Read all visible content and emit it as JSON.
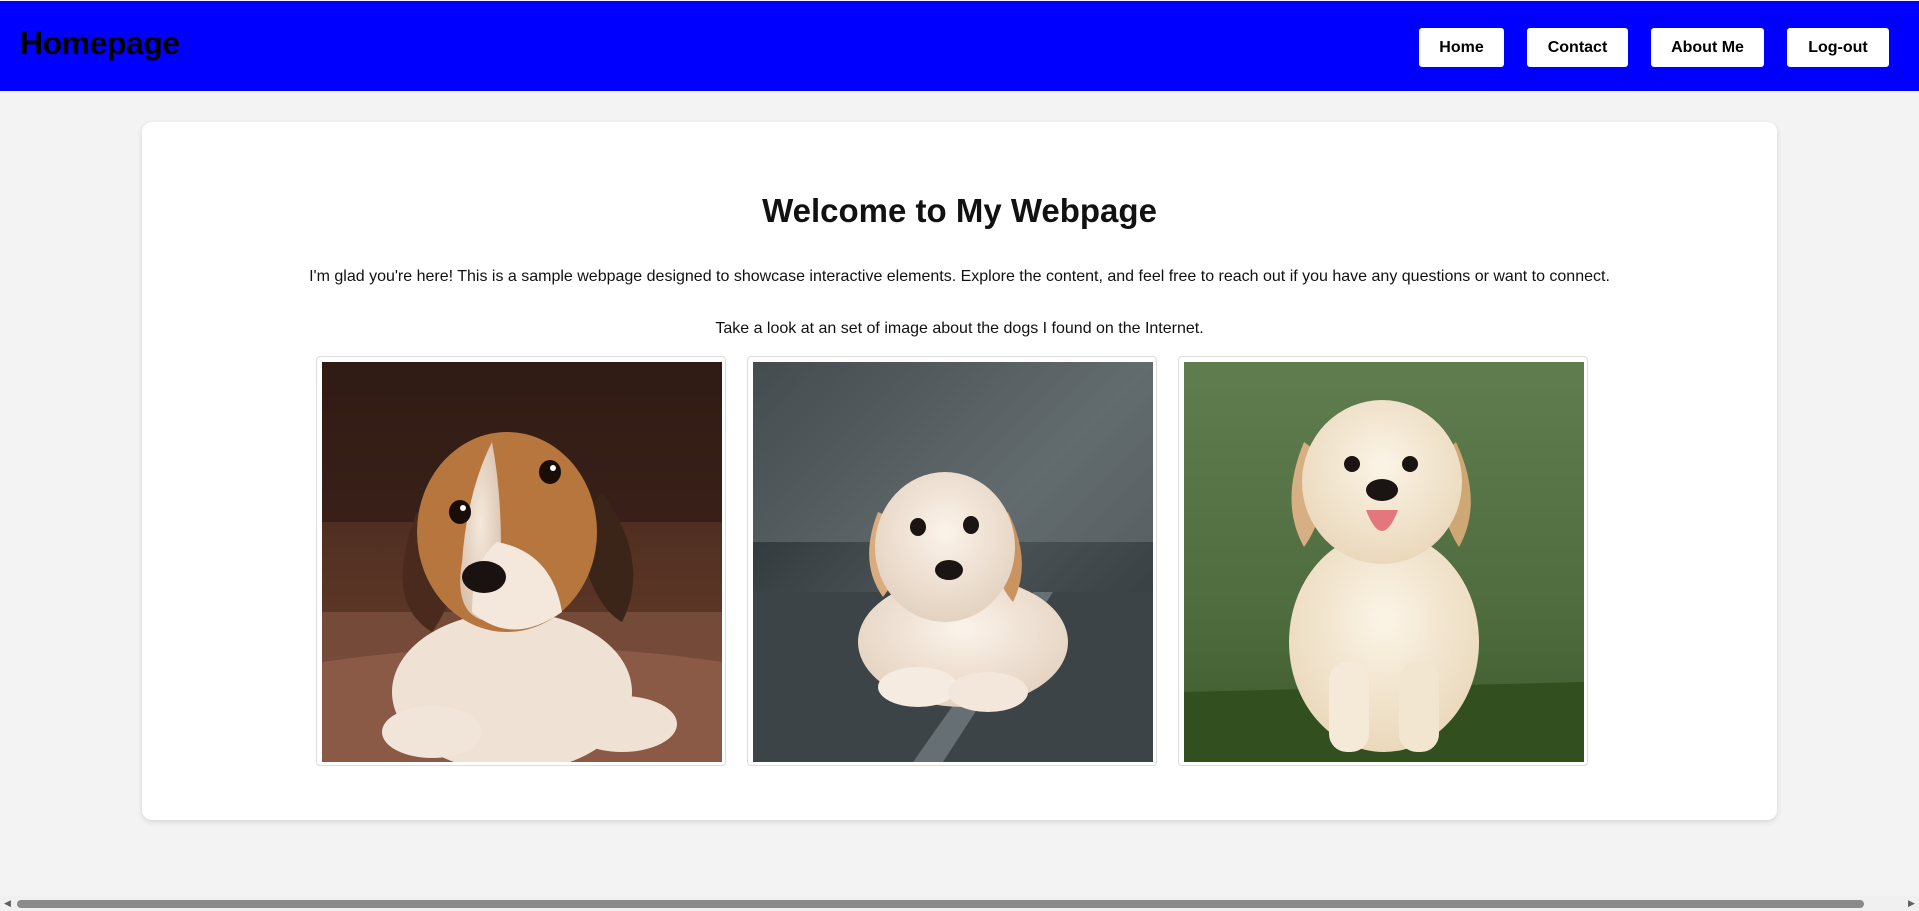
{
  "header": {
    "title": "Homepage",
    "background_color": "#0000ff",
    "nav": {
      "home": "Home",
      "contact": "Contact",
      "about": "About Me",
      "logout": "Log-out"
    }
  },
  "main": {
    "heading": "Welcome to My Webpage",
    "intro": "I'm glad you're here! This is a sample webpage designed to showcase interactive elements. Explore the content, and feel free to reach out if you have any questions or want to connect.",
    "gallery_caption": "Take a look at an set of image about the dogs I found on the Internet.",
    "images": [
      {
        "icon": "beagle-puppy-photo"
      },
      {
        "icon": "golden-retriever-puppy-lying-photo"
      },
      {
        "icon": "golden-retriever-puppy-sitting-photo"
      }
    ]
  },
  "scrollbar": {
    "left_arrow": "◀",
    "right_arrow": "▶"
  }
}
